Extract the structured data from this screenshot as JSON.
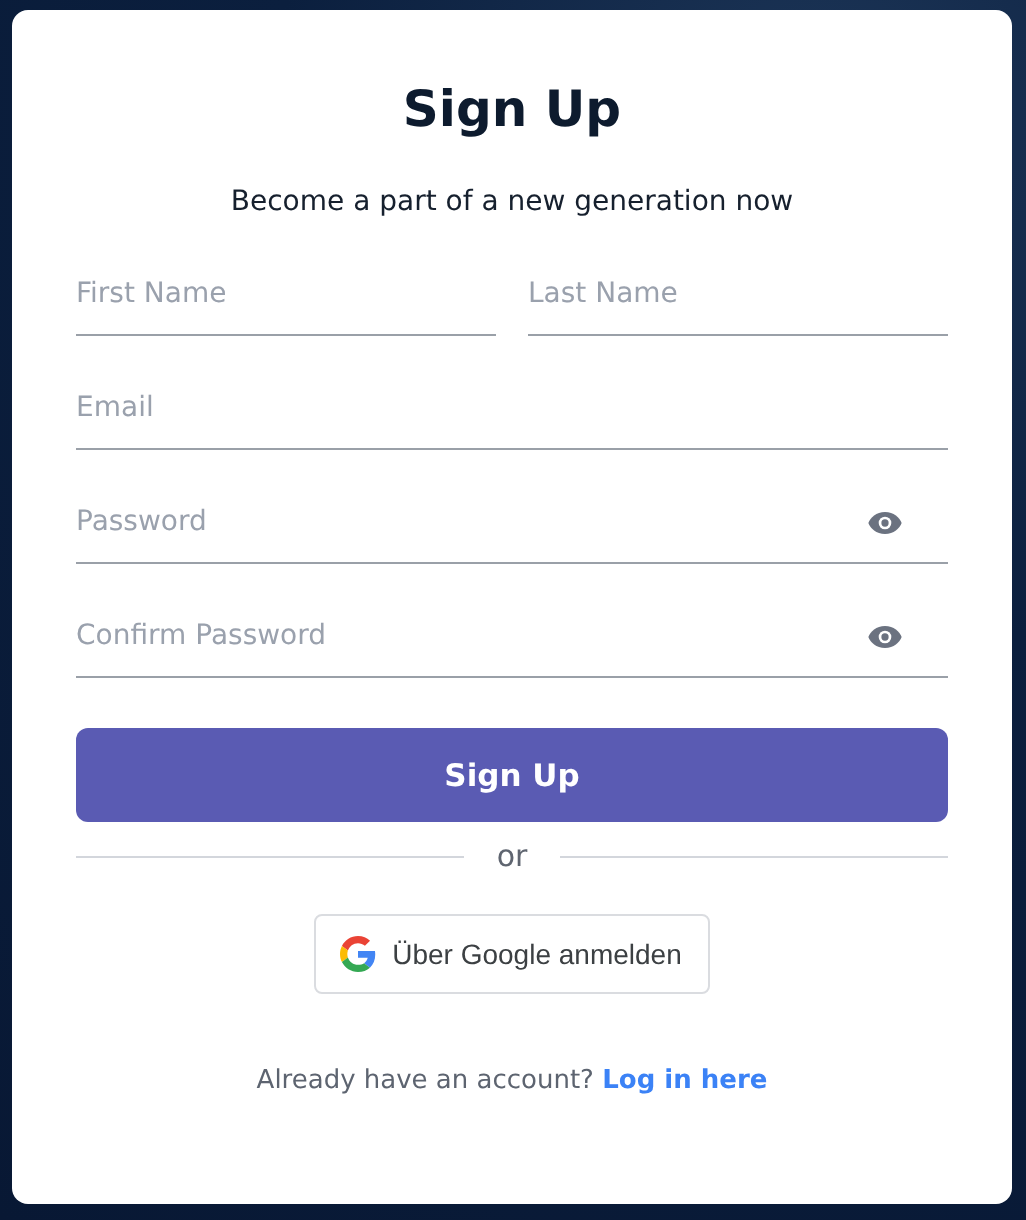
{
  "title": "Sign Up",
  "subtitle": "Become a part of a new generation now",
  "field_rows": [
    [
      {
        "placeholder": "First Name",
        "kind": "text"
      },
      {
        "placeholder": "Last Name",
        "kind": "text"
      }
    ],
    [
      {
        "placeholder": "Email",
        "kind": "text"
      }
    ],
    [
      {
        "placeholder": "Password",
        "kind": "password"
      }
    ],
    [
      {
        "placeholder": "Confirm Password",
        "kind": "password"
      }
    ]
  ],
  "submit_button": "Sign Up",
  "divider_text": "or",
  "google_button": "Über Google anmelden",
  "footer": {
    "text": "Already have an account?",
    "link": "Log in here"
  }
}
